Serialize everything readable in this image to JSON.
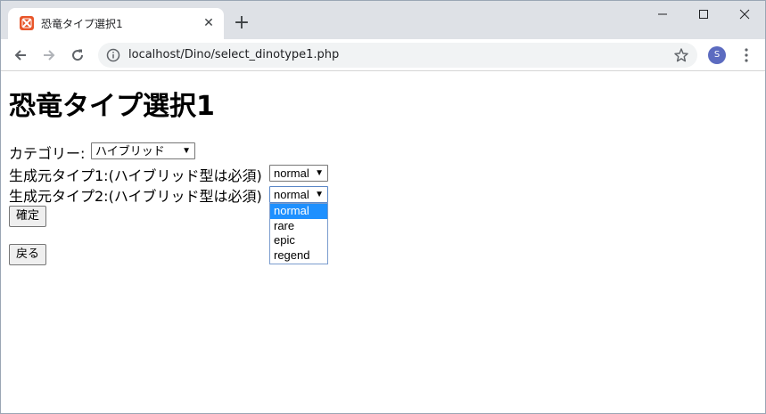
{
  "browser": {
    "tab_title": "恐竜タイプ選択1",
    "tab_close": "✕",
    "new_tab": "+",
    "url": "localhost/Dino/select_dinotype1.php",
    "avatar_initial": "S",
    "icons": [
      "xampp-favicon-icon",
      "back-arrow-icon",
      "forward-arrow-icon",
      "reload-icon",
      "info-icon",
      "star-icon",
      "kebab-menu-icon",
      "minimize-icon",
      "maximize-icon",
      "close-icon"
    ]
  },
  "page": {
    "title": "恐竜タイプ選択1",
    "category": {
      "label": "カテゴリー:",
      "value": "ハイブリッド"
    },
    "source1": {
      "label": "生成元タイプ1:(ハイブリッド型は必須)",
      "value": "normal"
    },
    "source2": {
      "label": "生成元タイプ2:(ハイブリッド型は必須)",
      "value": "normal",
      "options": [
        "normal",
        "rare",
        "epic",
        "regend"
      ],
      "highlighted_index": 0
    },
    "confirm_button": "確定",
    "back_button": "戻る"
  },
  "colors": {
    "tabstrip": "#dee1e6",
    "omnibox": "#f1f3f4",
    "avatar": "#5c6bc0",
    "dropdown_highlight": "#1e90ff"
  }
}
